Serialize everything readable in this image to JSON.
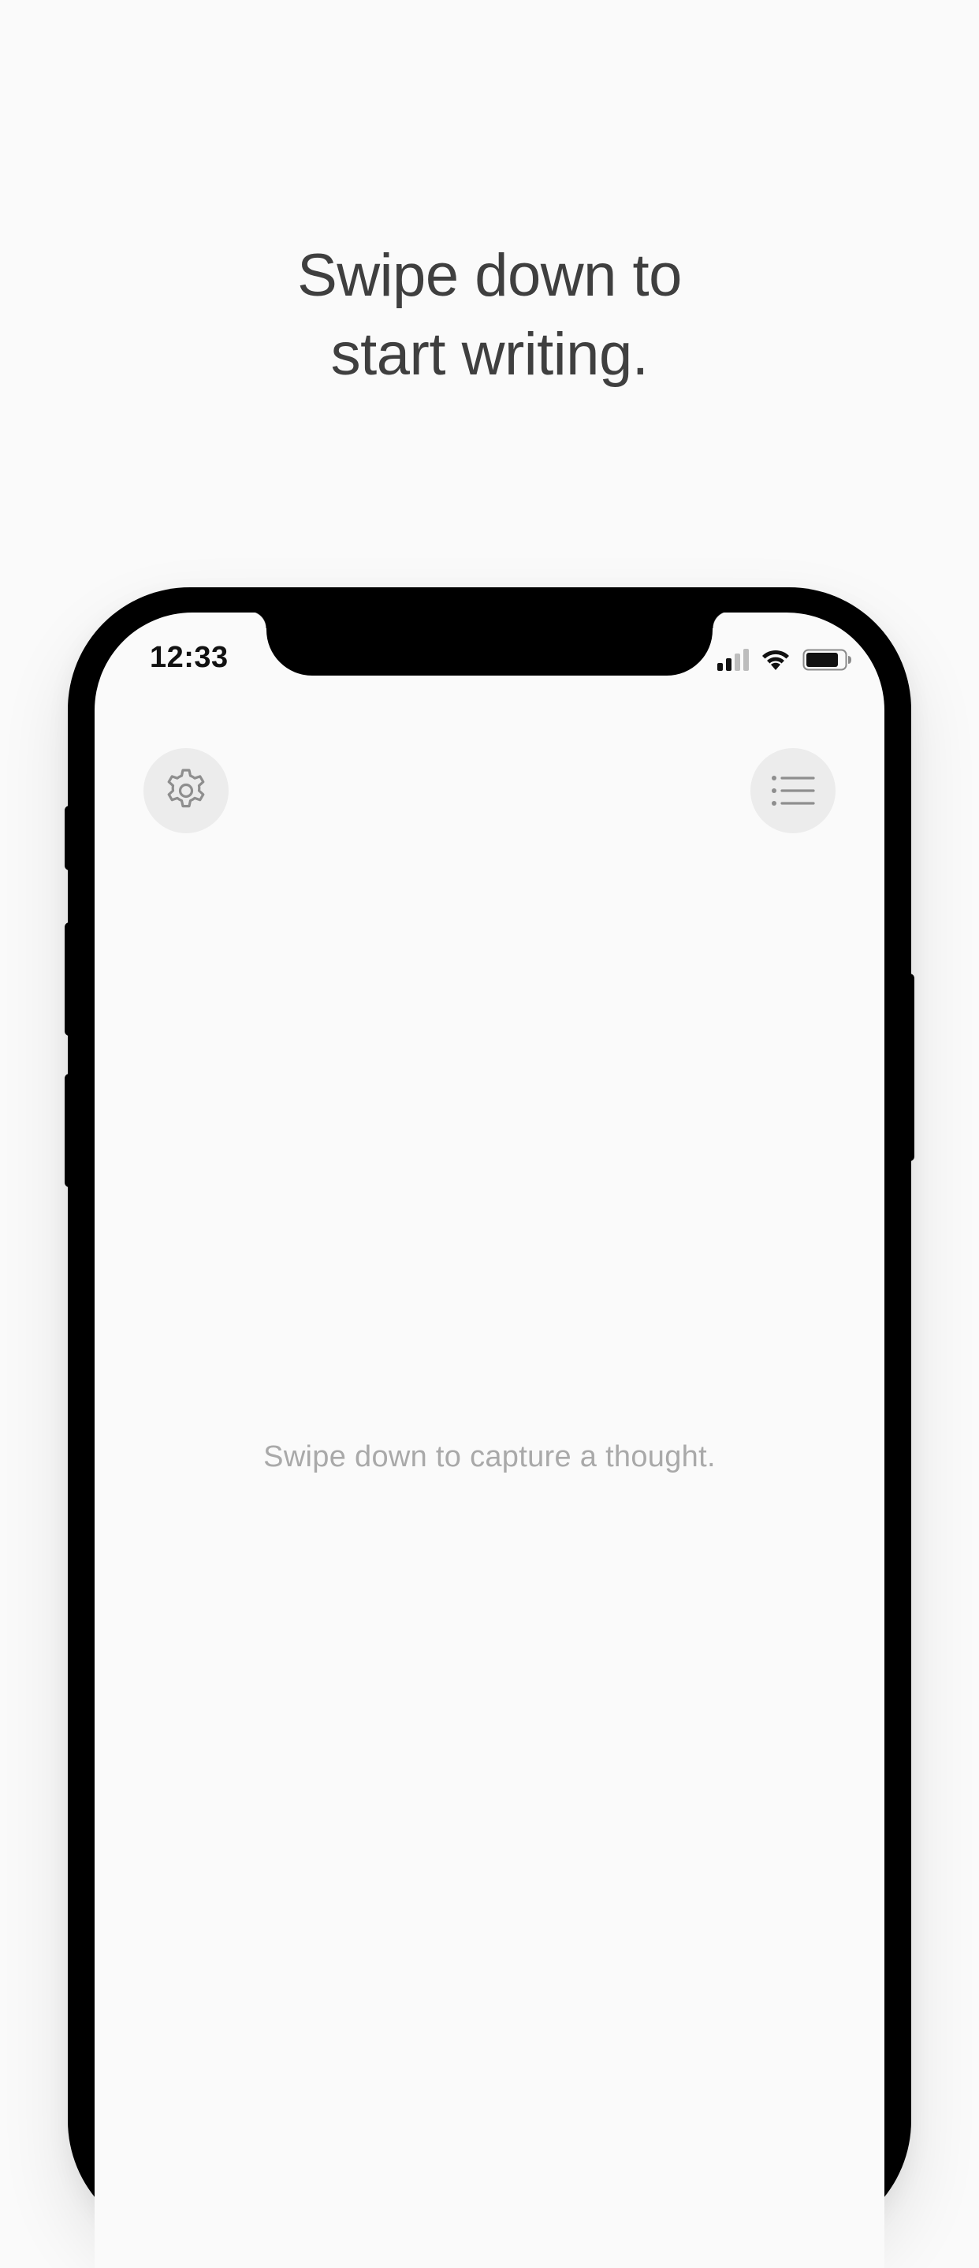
{
  "headline": {
    "line1": "Swipe down to",
    "line2": "start writing."
  },
  "status_bar": {
    "time": "12:33",
    "signal_icon": "cellular-signal-icon",
    "wifi_icon": "wifi-icon",
    "battery_icon": "battery-icon"
  },
  "toolbar": {
    "settings_icon": "gear-icon",
    "list_icon": "list-icon"
  },
  "main": {
    "placeholder": "Swipe down to capture a thought."
  },
  "colors": {
    "background": "#fafafa",
    "headline_text": "#3f3f3f",
    "placeholder_text": "#a9a9a9",
    "button_background": "#ececec",
    "icon_gray": "#8e8e8e",
    "device_frame": "#000000"
  }
}
